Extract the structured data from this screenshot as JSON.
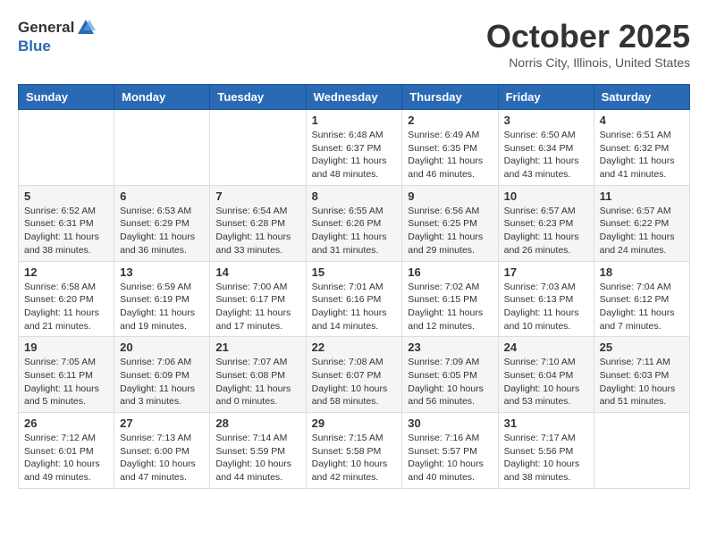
{
  "header": {
    "logo_general": "General",
    "logo_blue": "Blue",
    "month": "October 2025",
    "location": "Norris City, Illinois, United States"
  },
  "weekdays": [
    "Sunday",
    "Monday",
    "Tuesday",
    "Wednesday",
    "Thursday",
    "Friday",
    "Saturday"
  ],
  "weeks": [
    [
      {
        "day": "",
        "info": ""
      },
      {
        "day": "",
        "info": ""
      },
      {
        "day": "",
        "info": ""
      },
      {
        "day": "1",
        "info": "Sunrise: 6:48 AM\nSunset: 6:37 PM\nDaylight: 11 hours\nand 48 minutes."
      },
      {
        "day": "2",
        "info": "Sunrise: 6:49 AM\nSunset: 6:35 PM\nDaylight: 11 hours\nand 46 minutes."
      },
      {
        "day": "3",
        "info": "Sunrise: 6:50 AM\nSunset: 6:34 PM\nDaylight: 11 hours\nand 43 minutes."
      },
      {
        "day": "4",
        "info": "Sunrise: 6:51 AM\nSunset: 6:32 PM\nDaylight: 11 hours\nand 41 minutes."
      }
    ],
    [
      {
        "day": "5",
        "info": "Sunrise: 6:52 AM\nSunset: 6:31 PM\nDaylight: 11 hours\nand 38 minutes."
      },
      {
        "day": "6",
        "info": "Sunrise: 6:53 AM\nSunset: 6:29 PM\nDaylight: 11 hours\nand 36 minutes."
      },
      {
        "day": "7",
        "info": "Sunrise: 6:54 AM\nSunset: 6:28 PM\nDaylight: 11 hours\nand 33 minutes."
      },
      {
        "day": "8",
        "info": "Sunrise: 6:55 AM\nSunset: 6:26 PM\nDaylight: 11 hours\nand 31 minutes."
      },
      {
        "day": "9",
        "info": "Sunrise: 6:56 AM\nSunset: 6:25 PM\nDaylight: 11 hours\nand 29 minutes."
      },
      {
        "day": "10",
        "info": "Sunrise: 6:57 AM\nSunset: 6:23 PM\nDaylight: 11 hours\nand 26 minutes."
      },
      {
        "day": "11",
        "info": "Sunrise: 6:57 AM\nSunset: 6:22 PM\nDaylight: 11 hours\nand 24 minutes."
      }
    ],
    [
      {
        "day": "12",
        "info": "Sunrise: 6:58 AM\nSunset: 6:20 PM\nDaylight: 11 hours\nand 21 minutes."
      },
      {
        "day": "13",
        "info": "Sunrise: 6:59 AM\nSunset: 6:19 PM\nDaylight: 11 hours\nand 19 minutes."
      },
      {
        "day": "14",
        "info": "Sunrise: 7:00 AM\nSunset: 6:17 PM\nDaylight: 11 hours\nand 17 minutes."
      },
      {
        "day": "15",
        "info": "Sunrise: 7:01 AM\nSunset: 6:16 PM\nDaylight: 11 hours\nand 14 minutes."
      },
      {
        "day": "16",
        "info": "Sunrise: 7:02 AM\nSunset: 6:15 PM\nDaylight: 11 hours\nand 12 minutes."
      },
      {
        "day": "17",
        "info": "Sunrise: 7:03 AM\nSunset: 6:13 PM\nDaylight: 11 hours\nand 10 minutes."
      },
      {
        "day": "18",
        "info": "Sunrise: 7:04 AM\nSunset: 6:12 PM\nDaylight: 11 hours\nand 7 minutes."
      }
    ],
    [
      {
        "day": "19",
        "info": "Sunrise: 7:05 AM\nSunset: 6:11 PM\nDaylight: 11 hours\nand 5 minutes."
      },
      {
        "day": "20",
        "info": "Sunrise: 7:06 AM\nSunset: 6:09 PM\nDaylight: 11 hours\nand 3 minutes."
      },
      {
        "day": "21",
        "info": "Sunrise: 7:07 AM\nSunset: 6:08 PM\nDaylight: 11 hours\nand 0 minutes."
      },
      {
        "day": "22",
        "info": "Sunrise: 7:08 AM\nSunset: 6:07 PM\nDaylight: 10 hours\nand 58 minutes."
      },
      {
        "day": "23",
        "info": "Sunrise: 7:09 AM\nSunset: 6:05 PM\nDaylight: 10 hours\nand 56 minutes."
      },
      {
        "day": "24",
        "info": "Sunrise: 7:10 AM\nSunset: 6:04 PM\nDaylight: 10 hours\nand 53 minutes."
      },
      {
        "day": "25",
        "info": "Sunrise: 7:11 AM\nSunset: 6:03 PM\nDaylight: 10 hours\nand 51 minutes."
      }
    ],
    [
      {
        "day": "26",
        "info": "Sunrise: 7:12 AM\nSunset: 6:01 PM\nDaylight: 10 hours\nand 49 minutes."
      },
      {
        "day": "27",
        "info": "Sunrise: 7:13 AM\nSunset: 6:00 PM\nDaylight: 10 hours\nand 47 minutes."
      },
      {
        "day": "28",
        "info": "Sunrise: 7:14 AM\nSunset: 5:59 PM\nDaylight: 10 hours\nand 44 minutes."
      },
      {
        "day": "29",
        "info": "Sunrise: 7:15 AM\nSunset: 5:58 PM\nDaylight: 10 hours\nand 42 minutes."
      },
      {
        "day": "30",
        "info": "Sunrise: 7:16 AM\nSunset: 5:57 PM\nDaylight: 10 hours\nand 40 minutes."
      },
      {
        "day": "31",
        "info": "Sunrise: 7:17 AM\nSunset: 5:56 PM\nDaylight: 10 hours\nand 38 minutes."
      },
      {
        "day": "",
        "info": ""
      }
    ]
  ]
}
